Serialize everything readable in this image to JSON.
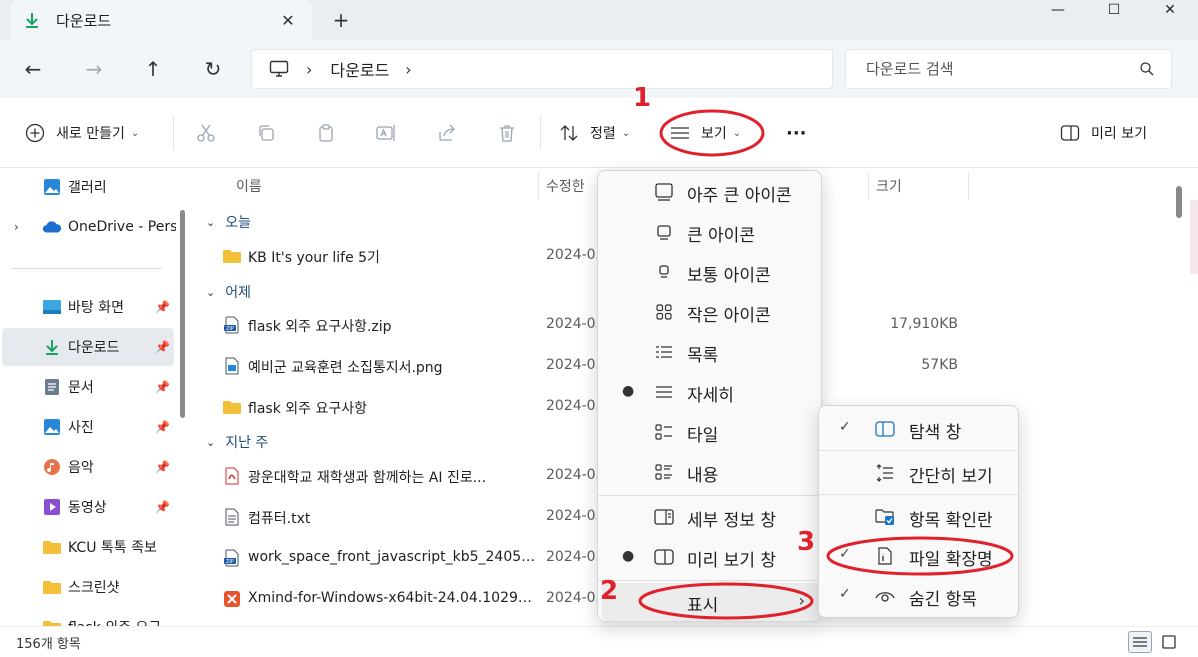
{
  "window": {
    "tab_title": "다운로드",
    "tab_close": "✕",
    "new_tab": "+",
    "controls": [
      "—",
      "☐",
      "✕"
    ]
  },
  "nav": {
    "back": "←",
    "forward": "→",
    "up": "↑",
    "refresh": "↻",
    "breadcrumb_sep": "›",
    "breadcrumb": [
      "다운로드"
    ],
    "breadcrumb_trailing_sep": "›",
    "search_placeholder": "다운로드 검색"
  },
  "toolbar": {
    "new_label": "새로 만들기",
    "sort_label": "정렬",
    "view_label": "보기",
    "more_label": "···",
    "preview_label": "미리 보기"
  },
  "sidebar": {
    "items": [
      {
        "label": "갤러리",
        "icon": "gallery-icon",
        "pinned": false
      },
      {
        "label": "OneDrive - Pers",
        "icon": "onedrive-icon",
        "pinned": false
      },
      {
        "label": "바탕 화면",
        "icon": "desktop-icon",
        "pinned": true
      },
      {
        "label": "다운로드",
        "icon": "download-icon",
        "pinned": true,
        "selected": true
      },
      {
        "label": "문서",
        "icon": "documents-icon",
        "pinned": true
      },
      {
        "label": "사진",
        "icon": "pictures-icon",
        "pinned": true
      },
      {
        "label": "음악",
        "icon": "music-icon",
        "pinned": true
      },
      {
        "label": "동영상",
        "icon": "videos-icon",
        "pinned": true
      },
      {
        "label": "KCU 톡톡 족보",
        "icon": "folder-icon",
        "pinned": false
      },
      {
        "label": "스크린샷",
        "icon": "folder-icon",
        "pinned": false
      },
      {
        "label": "flask 외주 요구",
        "icon": "folder-icon",
        "pinned": false
      }
    ]
  },
  "filelist": {
    "columns": {
      "name": "이름",
      "modified": "수정한",
      "size": "크기"
    },
    "groups": [
      {
        "label": "오늘"
      },
      {
        "label": "어제"
      },
      {
        "label": "지난 주"
      }
    ],
    "rows": [
      {
        "name": "KB It's your life 5기",
        "date": "2024-05",
        "size": "",
        "icon": "folder-icon"
      },
      {
        "name": "flask 외주 요구사항.zip",
        "date": "2024-05",
        "size": "17,910KB",
        "icon": "zip-icon"
      },
      {
        "name": "예비군 교육훈련 소집통지서.png",
        "date": "2024-05",
        "size": "57KB",
        "icon": "image-file-icon"
      },
      {
        "name": "flask 외주 요구사항",
        "date": "2024-05",
        "size": "",
        "icon": "folder-icon"
      },
      {
        "name": "광운대학교 재학생과 함께하는 AI 진로...",
        "date": "2024-05",
        "size": "",
        "icon": "pdf-icon"
      },
      {
        "name": "컴퓨터.txt",
        "date": "2024-05",
        "size": "",
        "icon": "text-file-icon"
      },
      {
        "name": "work_space_front_javascript_kb5_240509....",
        "date": "2024-05",
        "size": "",
        "icon": "zip-icon"
      },
      {
        "name": "Xmind-for-Windows-x64bit-24.04.10291...",
        "date": "2024-05",
        "size": "",
        "icon": "xmind-icon"
      }
    ]
  },
  "status": {
    "item_count": "156개 항목"
  },
  "view_menu": {
    "items": [
      {
        "label": "아주 큰 아이콘",
        "icon": "extra-large-icons-icon",
        "selected": false
      },
      {
        "label": "큰 아이콘",
        "icon": "large-icons-icon",
        "selected": false
      },
      {
        "label": "보통 아이콘",
        "icon": "medium-icons-icon",
        "selected": false
      },
      {
        "label": "작은 아이콘",
        "icon": "small-icons-icon",
        "selected": false
      },
      {
        "label": "목록",
        "icon": "list-icon",
        "selected": false
      },
      {
        "label": "자세히",
        "icon": "details-icon",
        "selected": true
      },
      {
        "label": "타일",
        "icon": "tiles-icon",
        "selected": false
      },
      {
        "label": "내용",
        "icon": "content-icon",
        "selected": false
      },
      {
        "label": "세부 정보 창",
        "icon": "details-pane-icon",
        "selected": false
      },
      {
        "label": "미리 보기 창",
        "icon": "preview-pane-icon",
        "selected": true
      },
      {
        "label": "표시",
        "icon": "",
        "selected": false,
        "submenu": true
      }
    ]
  },
  "show_submenu": {
    "items": [
      {
        "label": "탐색 창",
        "icon": "navigation-pane-icon",
        "checked": true
      },
      {
        "label": "간단히 보기",
        "icon": "compact-view-icon",
        "checked": false
      },
      {
        "label": "항목 확인란",
        "icon": "item-checkbox-icon",
        "checked": false
      },
      {
        "label": "파일 확장명",
        "icon": "file-extension-icon",
        "checked": true
      },
      {
        "label": "숨긴 항목",
        "icon": "hidden-items-icon",
        "checked": true
      }
    ]
  },
  "annotations": {
    "step1": "1",
    "step2": "2",
    "step3": "3",
    "color": "#e0202a"
  },
  "colors": {
    "accent": "#1a73c9",
    "selected_bg": "#e6e9ee",
    "annotation": "#e0202a"
  }
}
